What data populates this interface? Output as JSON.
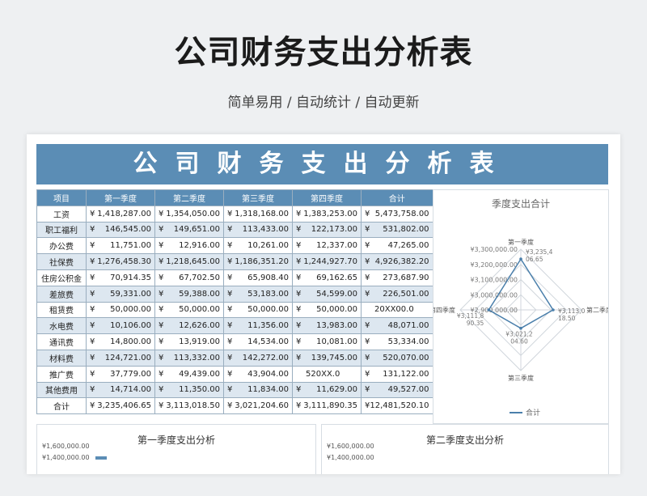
{
  "hero": {
    "title": "公司财务支出分析表",
    "subtitle": "简单易用 / 自动统计 / 自动更新"
  },
  "sheet": {
    "banner": "公司财务支出分析表",
    "headers": [
      "项目",
      "第一季度",
      "第二季度",
      "第三季度",
      "第四季度",
      "合计"
    ],
    "currency": "¥",
    "rows": [
      {
        "item": "工资",
        "q": [
          "1,418,287.00",
          "1,354,050.00",
          "1,318,168.00",
          "1,383,253.00"
        ],
        "total": "5,473,758.00"
      },
      {
        "item": "职工福利",
        "q": [
          "146,545.00",
          "149,651.00",
          "113,433.00",
          "122,173.00"
        ],
        "total": "531,802.00"
      },
      {
        "item": "办公费",
        "q": [
          "11,751.00",
          "12,916.00",
          "10,261.00",
          "12,337.00"
        ],
        "total": "47,265.00"
      },
      {
        "item": "社保费",
        "q": [
          "1,276,458.30",
          "1,218,645.00",
          "1,186,351.20",
          "1,244,927.70"
        ],
        "total": "4,926,382.20"
      },
      {
        "item": "住房公积金",
        "q": [
          "70,914.35",
          "67,702.50",
          "65,908.40",
          "69,162.65"
        ],
        "total": "273,687.90"
      },
      {
        "item": "差旅费",
        "q": [
          "59,331.00",
          "59,388.00",
          "53,183.00",
          "54,599.00"
        ],
        "total": "226,501.00"
      },
      {
        "item": "租赁费",
        "q": [
          "50,000.00",
          "50,000.00",
          "50,000.00",
          "50,000.00"
        ],
        "total": "20XX00.0",
        "total_plain": true
      },
      {
        "item": "水电费",
        "q": [
          "10,106.00",
          "12,626.00",
          "11,356.00",
          "13,983.00"
        ],
        "total": "48,071.00"
      },
      {
        "item": "通讯费",
        "q": [
          "14,800.00",
          "13,919.00",
          "14,534.00",
          "10,081.00"
        ],
        "total": "53,334.00"
      },
      {
        "item": "材料费",
        "q": [
          "124,721.00",
          "113,332.00",
          "142,272.00",
          "139,745.00"
        ],
        "total": "520,070.00"
      },
      {
        "item": "推广费",
        "q": [
          "37,779.00",
          "49,439.00",
          "43,904.00",
          "520XX.0"
        ],
        "q_plain": [
          false,
          false,
          false,
          true
        ],
        "total": "131,122.00"
      },
      {
        "item": "其他费用",
        "q": [
          "14,714.00",
          "11,350.00",
          "11,834.00",
          "11,629.00"
        ],
        "total": "49,527.00"
      },
      {
        "item": "合计",
        "q": [
          "3,235,406.65",
          "3,113,018.50",
          "3,021,204.60",
          "3,111,890.35"
        ],
        "total": "12,481,520.10"
      }
    ]
  },
  "radar": {
    "title": "季度支出合计",
    "axes": [
      "第一季度",
      "第二季度",
      "第三季度",
      "第四季度"
    ],
    "ring_labels": [
      "¥3,300,000.00",
      "¥3,200,000.00",
      "¥3,100,000.00",
      "¥3,000,000.00",
      "¥2,900,000.00"
    ],
    "point_labels": [
      "¥3,235,4\n06.65",
      "¥3,113,0\n18.50",
      "¥3,021,2\n04.60",
      "¥3,111,8\n90.35"
    ],
    "legend": "合计",
    "color": "#4a7fab"
  },
  "bottom": {
    "left_title": "第一季度支出分析",
    "right_title": "第二季度支出分析",
    "ticks": [
      "¥1,600,000.00",
      "¥1,400,000.00"
    ]
  },
  "chart_data": {
    "type": "radar",
    "title": "季度支出合计",
    "categories": [
      "第一季度",
      "第二季度",
      "第三季度",
      "第四季度"
    ],
    "series": [
      {
        "name": "合计",
        "values": [
          3235406.65,
          3113018.5,
          3021204.6,
          3111890.35
        ]
      }
    ],
    "rlim": [
      2900000,
      3300000
    ]
  }
}
